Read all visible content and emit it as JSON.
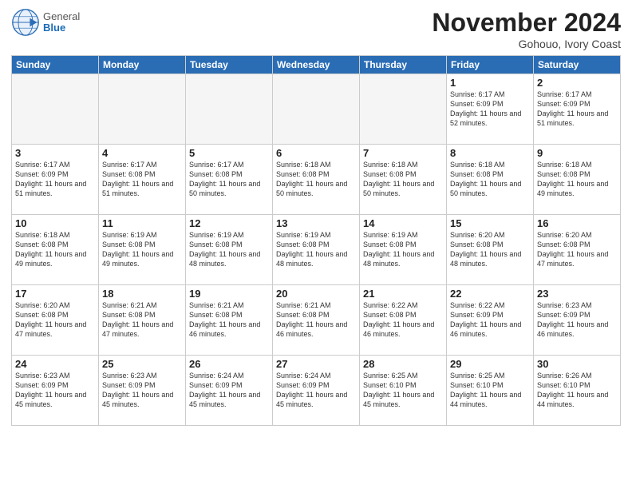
{
  "logo": {
    "general": "General",
    "blue": "Blue"
  },
  "header": {
    "month": "November 2024",
    "location": "Gohouo, Ivory Coast"
  },
  "weekdays": [
    "Sunday",
    "Monday",
    "Tuesday",
    "Wednesday",
    "Thursday",
    "Friday",
    "Saturday"
  ],
  "weeks": [
    [
      {
        "day": "",
        "info": ""
      },
      {
        "day": "",
        "info": ""
      },
      {
        "day": "",
        "info": ""
      },
      {
        "day": "",
        "info": ""
      },
      {
        "day": "",
        "info": ""
      },
      {
        "day": "1",
        "info": "Sunrise: 6:17 AM\nSunset: 6:09 PM\nDaylight: 11 hours and 52 minutes."
      },
      {
        "day": "2",
        "info": "Sunrise: 6:17 AM\nSunset: 6:09 PM\nDaylight: 11 hours and 51 minutes."
      }
    ],
    [
      {
        "day": "3",
        "info": "Sunrise: 6:17 AM\nSunset: 6:09 PM\nDaylight: 11 hours and 51 minutes."
      },
      {
        "day": "4",
        "info": "Sunrise: 6:17 AM\nSunset: 6:08 PM\nDaylight: 11 hours and 51 minutes."
      },
      {
        "day": "5",
        "info": "Sunrise: 6:17 AM\nSunset: 6:08 PM\nDaylight: 11 hours and 50 minutes."
      },
      {
        "day": "6",
        "info": "Sunrise: 6:18 AM\nSunset: 6:08 PM\nDaylight: 11 hours and 50 minutes."
      },
      {
        "day": "7",
        "info": "Sunrise: 6:18 AM\nSunset: 6:08 PM\nDaylight: 11 hours and 50 minutes."
      },
      {
        "day": "8",
        "info": "Sunrise: 6:18 AM\nSunset: 6:08 PM\nDaylight: 11 hours and 50 minutes."
      },
      {
        "day": "9",
        "info": "Sunrise: 6:18 AM\nSunset: 6:08 PM\nDaylight: 11 hours and 49 minutes."
      }
    ],
    [
      {
        "day": "10",
        "info": "Sunrise: 6:18 AM\nSunset: 6:08 PM\nDaylight: 11 hours and 49 minutes."
      },
      {
        "day": "11",
        "info": "Sunrise: 6:19 AM\nSunset: 6:08 PM\nDaylight: 11 hours and 49 minutes."
      },
      {
        "day": "12",
        "info": "Sunrise: 6:19 AM\nSunset: 6:08 PM\nDaylight: 11 hours and 48 minutes."
      },
      {
        "day": "13",
        "info": "Sunrise: 6:19 AM\nSunset: 6:08 PM\nDaylight: 11 hours and 48 minutes."
      },
      {
        "day": "14",
        "info": "Sunrise: 6:19 AM\nSunset: 6:08 PM\nDaylight: 11 hours and 48 minutes."
      },
      {
        "day": "15",
        "info": "Sunrise: 6:20 AM\nSunset: 6:08 PM\nDaylight: 11 hours and 48 minutes."
      },
      {
        "day": "16",
        "info": "Sunrise: 6:20 AM\nSunset: 6:08 PM\nDaylight: 11 hours and 47 minutes."
      }
    ],
    [
      {
        "day": "17",
        "info": "Sunrise: 6:20 AM\nSunset: 6:08 PM\nDaylight: 11 hours and 47 minutes."
      },
      {
        "day": "18",
        "info": "Sunrise: 6:21 AM\nSunset: 6:08 PM\nDaylight: 11 hours and 47 minutes."
      },
      {
        "day": "19",
        "info": "Sunrise: 6:21 AM\nSunset: 6:08 PM\nDaylight: 11 hours and 46 minutes."
      },
      {
        "day": "20",
        "info": "Sunrise: 6:21 AM\nSunset: 6:08 PM\nDaylight: 11 hours and 46 minutes."
      },
      {
        "day": "21",
        "info": "Sunrise: 6:22 AM\nSunset: 6:08 PM\nDaylight: 11 hours and 46 minutes."
      },
      {
        "day": "22",
        "info": "Sunrise: 6:22 AM\nSunset: 6:09 PM\nDaylight: 11 hours and 46 minutes."
      },
      {
        "day": "23",
        "info": "Sunrise: 6:23 AM\nSunset: 6:09 PM\nDaylight: 11 hours and 46 minutes."
      }
    ],
    [
      {
        "day": "24",
        "info": "Sunrise: 6:23 AM\nSunset: 6:09 PM\nDaylight: 11 hours and 45 minutes."
      },
      {
        "day": "25",
        "info": "Sunrise: 6:23 AM\nSunset: 6:09 PM\nDaylight: 11 hours and 45 minutes."
      },
      {
        "day": "26",
        "info": "Sunrise: 6:24 AM\nSunset: 6:09 PM\nDaylight: 11 hours and 45 minutes."
      },
      {
        "day": "27",
        "info": "Sunrise: 6:24 AM\nSunset: 6:09 PM\nDaylight: 11 hours and 45 minutes."
      },
      {
        "day": "28",
        "info": "Sunrise: 6:25 AM\nSunset: 6:10 PM\nDaylight: 11 hours and 45 minutes."
      },
      {
        "day": "29",
        "info": "Sunrise: 6:25 AM\nSunset: 6:10 PM\nDaylight: 11 hours and 44 minutes."
      },
      {
        "day": "30",
        "info": "Sunrise: 6:26 AM\nSunset: 6:10 PM\nDaylight: 11 hours and 44 minutes."
      }
    ]
  ]
}
